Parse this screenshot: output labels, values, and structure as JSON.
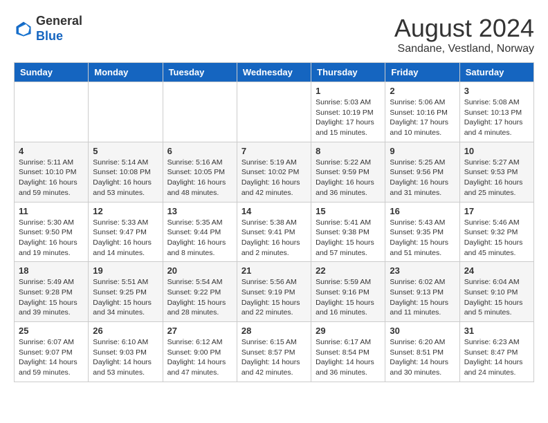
{
  "header": {
    "logo_general": "General",
    "logo_blue": "Blue",
    "month_year": "August 2024",
    "location": "Sandane, Vestland, Norway"
  },
  "days_of_week": [
    "Sunday",
    "Monday",
    "Tuesday",
    "Wednesday",
    "Thursday",
    "Friday",
    "Saturday"
  ],
  "weeks": [
    [
      {
        "day": "",
        "content": ""
      },
      {
        "day": "",
        "content": ""
      },
      {
        "day": "",
        "content": ""
      },
      {
        "day": "",
        "content": ""
      },
      {
        "day": "1",
        "content": "Sunrise: 5:03 AM\nSunset: 10:19 PM\nDaylight: 17 hours\nand 15 minutes."
      },
      {
        "day": "2",
        "content": "Sunrise: 5:06 AM\nSunset: 10:16 PM\nDaylight: 17 hours\nand 10 minutes."
      },
      {
        "day": "3",
        "content": "Sunrise: 5:08 AM\nSunset: 10:13 PM\nDaylight: 17 hours\nand 4 minutes."
      }
    ],
    [
      {
        "day": "4",
        "content": "Sunrise: 5:11 AM\nSunset: 10:10 PM\nDaylight: 16 hours\nand 59 minutes."
      },
      {
        "day": "5",
        "content": "Sunrise: 5:14 AM\nSunset: 10:08 PM\nDaylight: 16 hours\nand 53 minutes."
      },
      {
        "day": "6",
        "content": "Sunrise: 5:16 AM\nSunset: 10:05 PM\nDaylight: 16 hours\nand 48 minutes."
      },
      {
        "day": "7",
        "content": "Sunrise: 5:19 AM\nSunset: 10:02 PM\nDaylight: 16 hours\nand 42 minutes."
      },
      {
        "day": "8",
        "content": "Sunrise: 5:22 AM\nSunset: 9:59 PM\nDaylight: 16 hours\nand 36 minutes."
      },
      {
        "day": "9",
        "content": "Sunrise: 5:25 AM\nSunset: 9:56 PM\nDaylight: 16 hours\nand 31 minutes."
      },
      {
        "day": "10",
        "content": "Sunrise: 5:27 AM\nSunset: 9:53 PM\nDaylight: 16 hours\nand 25 minutes."
      }
    ],
    [
      {
        "day": "11",
        "content": "Sunrise: 5:30 AM\nSunset: 9:50 PM\nDaylight: 16 hours\nand 19 minutes."
      },
      {
        "day": "12",
        "content": "Sunrise: 5:33 AM\nSunset: 9:47 PM\nDaylight: 16 hours\nand 14 minutes."
      },
      {
        "day": "13",
        "content": "Sunrise: 5:35 AM\nSunset: 9:44 PM\nDaylight: 16 hours\nand 8 minutes."
      },
      {
        "day": "14",
        "content": "Sunrise: 5:38 AM\nSunset: 9:41 PM\nDaylight: 16 hours\nand 2 minutes."
      },
      {
        "day": "15",
        "content": "Sunrise: 5:41 AM\nSunset: 9:38 PM\nDaylight: 15 hours\nand 57 minutes."
      },
      {
        "day": "16",
        "content": "Sunrise: 5:43 AM\nSunset: 9:35 PM\nDaylight: 15 hours\nand 51 minutes."
      },
      {
        "day": "17",
        "content": "Sunrise: 5:46 AM\nSunset: 9:32 PM\nDaylight: 15 hours\nand 45 minutes."
      }
    ],
    [
      {
        "day": "18",
        "content": "Sunrise: 5:49 AM\nSunset: 9:28 PM\nDaylight: 15 hours\nand 39 minutes."
      },
      {
        "day": "19",
        "content": "Sunrise: 5:51 AM\nSunset: 9:25 PM\nDaylight: 15 hours\nand 34 minutes."
      },
      {
        "day": "20",
        "content": "Sunrise: 5:54 AM\nSunset: 9:22 PM\nDaylight: 15 hours\nand 28 minutes."
      },
      {
        "day": "21",
        "content": "Sunrise: 5:56 AM\nSunset: 9:19 PM\nDaylight: 15 hours\nand 22 minutes."
      },
      {
        "day": "22",
        "content": "Sunrise: 5:59 AM\nSunset: 9:16 PM\nDaylight: 15 hours\nand 16 minutes."
      },
      {
        "day": "23",
        "content": "Sunrise: 6:02 AM\nSunset: 9:13 PM\nDaylight: 15 hours\nand 11 minutes."
      },
      {
        "day": "24",
        "content": "Sunrise: 6:04 AM\nSunset: 9:10 PM\nDaylight: 15 hours\nand 5 minutes."
      }
    ],
    [
      {
        "day": "25",
        "content": "Sunrise: 6:07 AM\nSunset: 9:07 PM\nDaylight: 14 hours\nand 59 minutes."
      },
      {
        "day": "26",
        "content": "Sunrise: 6:10 AM\nSunset: 9:03 PM\nDaylight: 14 hours\nand 53 minutes."
      },
      {
        "day": "27",
        "content": "Sunrise: 6:12 AM\nSunset: 9:00 PM\nDaylight: 14 hours\nand 47 minutes."
      },
      {
        "day": "28",
        "content": "Sunrise: 6:15 AM\nSunset: 8:57 PM\nDaylight: 14 hours\nand 42 minutes."
      },
      {
        "day": "29",
        "content": "Sunrise: 6:17 AM\nSunset: 8:54 PM\nDaylight: 14 hours\nand 36 minutes."
      },
      {
        "day": "30",
        "content": "Sunrise: 6:20 AM\nSunset: 8:51 PM\nDaylight: 14 hours\nand 30 minutes."
      },
      {
        "day": "31",
        "content": "Sunrise: 6:23 AM\nSunset: 8:47 PM\nDaylight: 14 hours\nand 24 minutes."
      }
    ]
  ]
}
